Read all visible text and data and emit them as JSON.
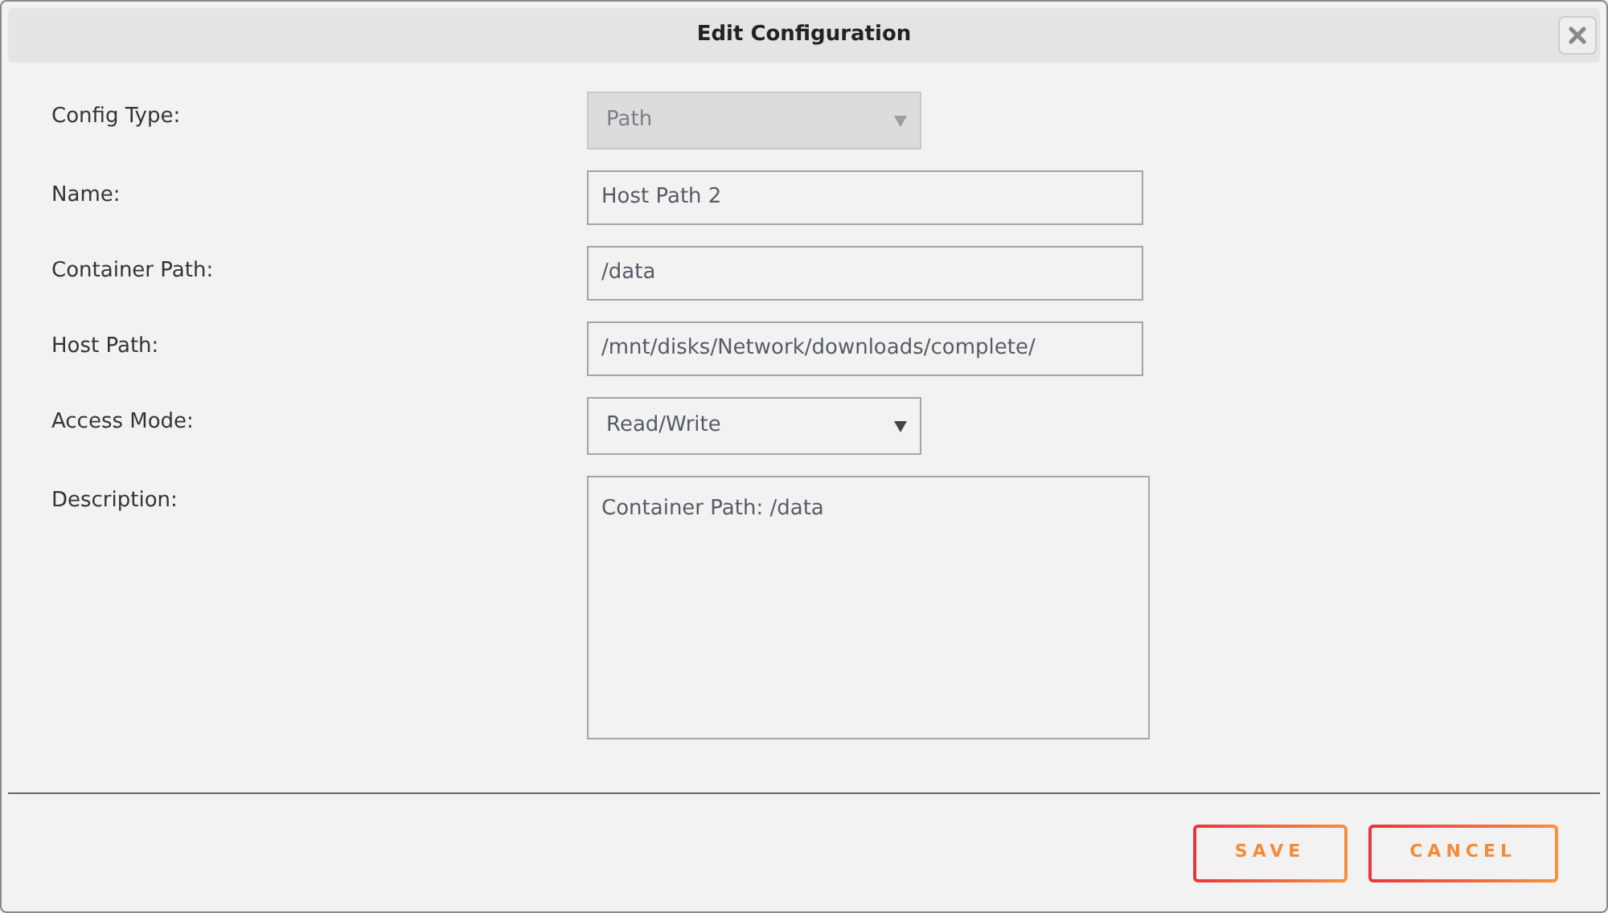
{
  "dialog": {
    "title": "Edit Configuration"
  },
  "fields": [
    {
      "label": "Config Type:",
      "kind": "select",
      "value": "Path",
      "disabled": true
    },
    {
      "label": "Name:",
      "kind": "input",
      "value": "Host Path 2",
      "disabled": false
    },
    {
      "label": "Container Path:",
      "kind": "input",
      "value": "/data",
      "disabled": false
    },
    {
      "label": "Host Path:",
      "kind": "input",
      "value": "/mnt/disks/Network/downloads/complete/",
      "disabled": false
    },
    {
      "label": "Access Mode:",
      "kind": "select",
      "value": "Read/Write",
      "disabled": false
    },
    {
      "label": "Description:",
      "kind": "textarea",
      "value": "Container Path: /data",
      "disabled": false
    }
  ],
  "buttons": [
    "SAVE",
    "CANCEL"
  ]
}
